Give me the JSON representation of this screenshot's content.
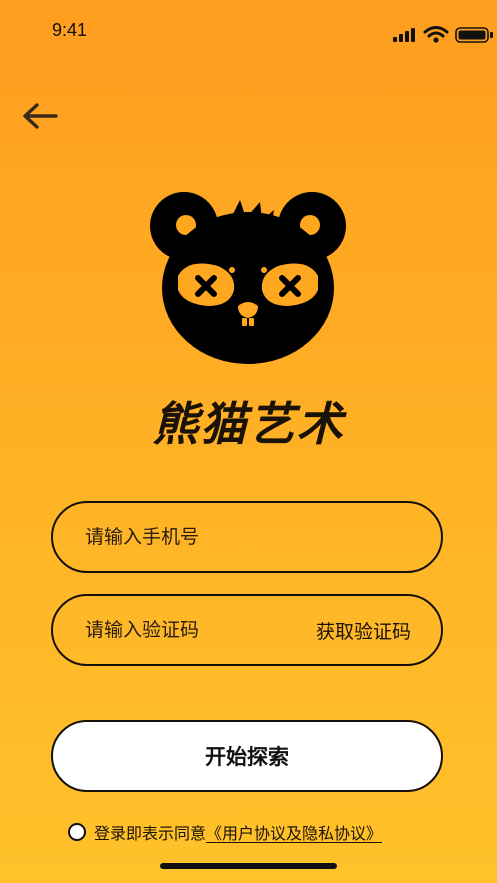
{
  "status_bar": {
    "time": "9:41",
    "icons": [
      "cellular-signal-icon",
      "wifi-icon",
      "battery-icon"
    ]
  },
  "nav": {
    "back_icon": "arrow-left-icon"
  },
  "brand": {
    "logo_icon": "panda-mascot-icon",
    "name": "熊猫艺术"
  },
  "form": {
    "phone_placeholder": "请输入手机号",
    "code_placeholder": "请输入验证码",
    "get_code_label": "获取验证码",
    "submit_label": "开始探索"
  },
  "agreement": {
    "prefix": "登录即表示同意",
    "link": "《用户协议及隐私协议》"
  },
  "colors": {
    "background_top": "#ff9d1f",
    "background_bottom": "#ffc22b",
    "outline": "#16100a",
    "button_fill": "#ffffff"
  }
}
